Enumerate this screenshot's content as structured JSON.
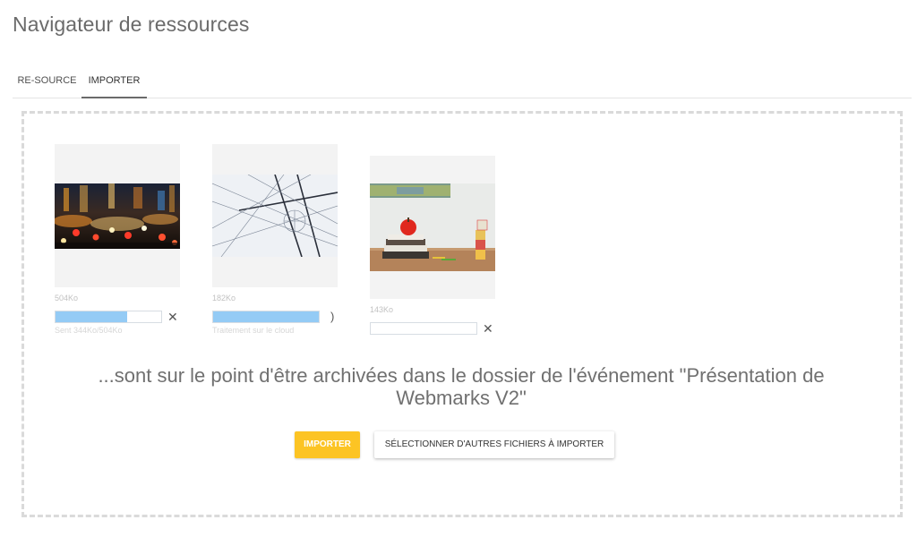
{
  "title": "Navigateur de ressources",
  "tabs": [
    {
      "label": "RE-SOURCE"
    },
    {
      "label": "IMPORTER"
    }
  ],
  "files": [
    {
      "size": "504Ko",
      "progress": 0.68,
      "status": "Sent 344Ko/504Ko",
      "icon": "close-icon",
      "icon_glyph": "✕"
    },
    {
      "size": "182Ko",
      "progress": 1.0,
      "status": "Traitement sur le cloud",
      "icon": "spinner-icon",
      "icon_glyph": ")"
    },
    {
      "size": "143Ko",
      "progress": 0.0,
      "status": "",
      "icon": "close-icon",
      "icon_glyph": "✕"
    }
  ],
  "message": "...sont sur le point d'être archivées dans le dossier de l'événement \"Présentation de Webmarks V2\"",
  "buttons": {
    "import": "IMPORTER",
    "select_more": "SÉLECTIONNER D'AUTRES FICHIERS À IMPORTER"
  },
  "colors": {
    "accent": "#fcc424",
    "progress_fill": "#94cbf5"
  }
}
